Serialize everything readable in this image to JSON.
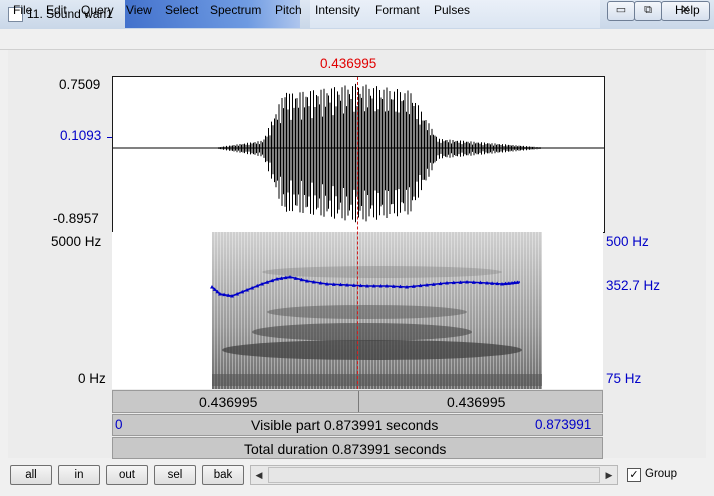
{
  "window": {
    "title": "11. Sound wan1",
    "minimize": "▭",
    "maximize": "⧉",
    "close": "✕"
  },
  "menu": {
    "items": [
      "File",
      "Edit",
      "Query",
      "View",
      "Select",
      "Spectrum",
      "Pitch",
      "Intensity",
      "Formant",
      "Pulses"
    ],
    "help": "Help"
  },
  "cursor_time": "0.436995",
  "waveform": {
    "max": "0.7509",
    "cursor_value": "0.1093",
    "min": "-0.8957"
  },
  "spectrogram": {
    "freq_top": "5000 Hz",
    "freq_bottom": "0 Hz"
  },
  "pitch": {
    "top": "500 Hz",
    "cursor": "352.7 Hz",
    "bottom": "75 Hz"
  },
  "time_bar": {
    "left": "0.436995",
    "right": "0.436995"
  },
  "visible_bar": {
    "start": "0",
    "text": "Visible part 0.873991 seconds",
    "end": "0.873991"
  },
  "total_bar": {
    "text": "Total duration 0.873991 seconds"
  },
  "zoom_buttons": [
    "all",
    "in",
    "out",
    "sel",
    "bak"
  ],
  "scroll": {
    "left_arrow": "◀",
    "right_arrow": "▶"
  },
  "group": {
    "label": "Group",
    "checked": "✓"
  },
  "colors": {
    "cursor": "#e00000",
    "pitch": "#0000c8",
    "accent_titlebar": "#2a5fc7"
  }
}
